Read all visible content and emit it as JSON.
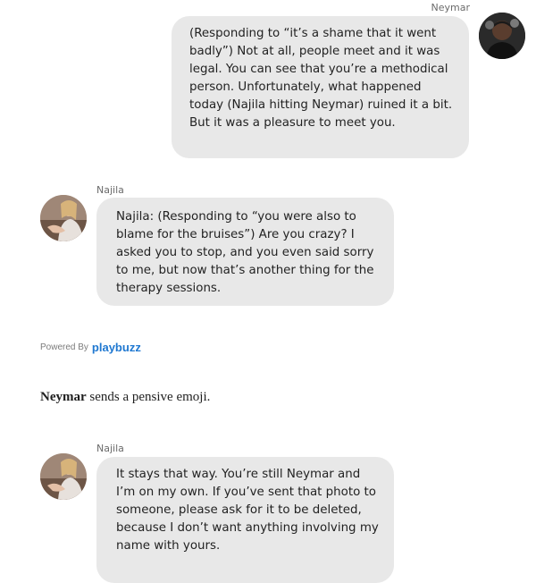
{
  "conversation": {
    "neymar_message": {
      "sender": "Neymar",
      "text": "(Responding to “it’s a shame that it went badly”) Not at all, people meet and it was legal. You can see that you’re a methodical person. Unfortunately, what happened today (Najila hitting Neymar) ruined it a bit. But it was a pleasure to meet you."
    },
    "najila_message_1": {
      "sender": "Najila",
      "text": "Najila: (Responding to “you were also to blame for the bruises”) Are you crazy? I asked you to stop, and you even said sorry to me, but now that’s another thing for the therapy sessions."
    },
    "najila_message_2": {
      "sender": "Najila",
      "text": "It stays that way. You’re still Neymar and I’m on my own. If you’ve sent that photo to someone, please ask for it to be deleted, because I don’t want anything involving my name with yours."
    }
  },
  "embed": {
    "powered_by": "Powered By",
    "logo_text": "playbuzz",
    "logo_color": "#1f78d1"
  },
  "narration": {
    "actor": "Neymar",
    "text": " sends a pensive emoji."
  },
  "colors": {
    "bubble_bg": "#e8e8e8",
    "sender_label": "#6b6b6b",
    "text": "#222222"
  }
}
